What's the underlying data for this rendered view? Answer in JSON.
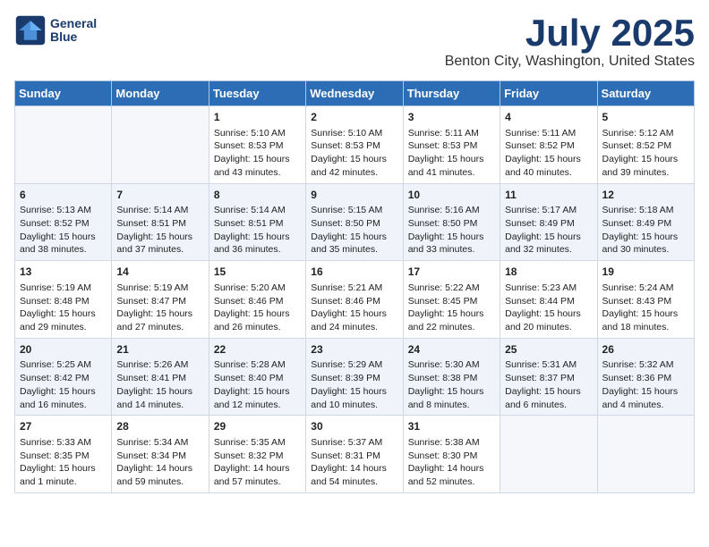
{
  "header": {
    "logo_line1": "General",
    "logo_line2": "Blue",
    "month": "July 2025",
    "location": "Benton City, Washington, United States"
  },
  "weekdays": [
    "Sunday",
    "Monday",
    "Tuesday",
    "Wednesday",
    "Thursday",
    "Friday",
    "Saturday"
  ],
  "weeks": [
    [
      {
        "day": "",
        "sunrise": "",
        "sunset": "",
        "daylight": ""
      },
      {
        "day": "",
        "sunrise": "",
        "sunset": "",
        "daylight": ""
      },
      {
        "day": "1",
        "sunrise": "Sunrise: 5:10 AM",
        "sunset": "Sunset: 8:53 PM",
        "daylight": "Daylight: 15 hours and 43 minutes."
      },
      {
        "day": "2",
        "sunrise": "Sunrise: 5:10 AM",
        "sunset": "Sunset: 8:53 PM",
        "daylight": "Daylight: 15 hours and 42 minutes."
      },
      {
        "day": "3",
        "sunrise": "Sunrise: 5:11 AM",
        "sunset": "Sunset: 8:53 PM",
        "daylight": "Daylight: 15 hours and 41 minutes."
      },
      {
        "day": "4",
        "sunrise": "Sunrise: 5:11 AM",
        "sunset": "Sunset: 8:52 PM",
        "daylight": "Daylight: 15 hours and 40 minutes."
      },
      {
        "day": "5",
        "sunrise": "Sunrise: 5:12 AM",
        "sunset": "Sunset: 8:52 PM",
        "daylight": "Daylight: 15 hours and 39 minutes."
      }
    ],
    [
      {
        "day": "6",
        "sunrise": "Sunrise: 5:13 AM",
        "sunset": "Sunset: 8:52 PM",
        "daylight": "Daylight: 15 hours and 38 minutes."
      },
      {
        "day": "7",
        "sunrise": "Sunrise: 5:14 AM",
        "sunset": "Sunset: 8:51 PM",
        "daylight": "Daylight: 15 hours and 37 minutes."
      },
      {
        "day": "8",
        "sunrise": "Sunrise: 5:14 AM",
        "sunset": "Sunset: 8:51 PM",
        "daylight": "Daylight: 15 hours and 36 minutes."
      },
      {
        "day": "9",
        "sunrise": "Sunrise: 5:15 AM",
        "sunset": "Sunset: 8:50 PM",
        "daylight": "Daylight: 15 hours and 35 minutes."
      },
      {
        "day": "10",
        "sunrise": "Sunrise: 5:16 AM",
        "sunset": "Sunset: 8:50 PM",
        "daylight": "Daylight: 15 hours and 33 minutes."
      },
      {
        "day": "11",
        "sunrise": "Sunrise: 5:17 AM",
        "sunset": "Sunset: 8:49 PM",
        "daylight": "Daylight: 15 hours and 32 minutes."
      },
      {
        "day": "12",
        "sunrise": "Sunrise: 5:18 AM",
        "sunset": "Sunset: 8:49 PM",
        "daylight": "Daylight: 15 hours and 30 minutes."
      }
    ],
    [
      {
        "day": "13",
        "sunrise": "Sunrise: 5:19 AM",
        "sunset": "Sunset: 8:48 PM",
        "daylight": "Daylight: 15 hours and 29 minutes."
      },
      {
        "day": "14",
        "sunrise": "Sunrise: 5:19 AM",
        "sunset": "Sunset: 8:47 PM",
        "daylight": "Daylight: 15 hours and 27 minutes."
      },
      {
        "day": "15",
        "sunrise": "Sunrise: 5:20 AM",
        "sunset": "Sunset: 8:46 PM",
        "daylight": "Daylight: 15 hours and 26 minutes."
      },
      {
        "day": "16",
        "sunrise": "Sunrise: 5:21 AM",
        "sunset": "Sunset: 8:46 PM",
        "daylight": "Daylight: 15 hours and 24 minutes."
      },
      {
        "day": "17",
        "sunrise": "Sunrise: 5:22 AM",
        "sunset": "Sunset: 8:45 PM",
        "daylight": "Daylight: 15 hours and 22 minutes."
      },
      {
        "day": "18",
        "sunrise": "Sunrise: 5:23 AM",
        "sunset": "Sunset: 8:44 PM",
        "daylight": "Daylight: 15 hours and 20 minutes."
      },
      {
        "day": "19",
        "sunrise": "Sunrise: 5:24 AM",
        "sunset": "Sunset: 8:43 PM",
        "daylight": "Daylight: 15 hours and 18 minutes."
      }
    ],
    [
      {
        "day": "20",
        "sunrise": "Sunrise: 5:25 AM",
        "sunset": "Sunset: 8:42 PM",
        "daylight": "Daylight: 15 hours and 16 minutes."
      },
      {
        "day": "21",
        "sunrise": "Sunrise: 5:26 AM",
        "sunset": "Sunset: 8:41 PM",
        "daylight": "Daylight: 15 hours and 14 minutes."
      },
      {
        "day": "22",
        "sunrise": "Sunrise: 5:28 AM",
        "sunset": "Sunset: 8:40 PM",
        "daylight": "Daylight: 15 hours and 12 minutes."
      },
      {
        "day": "23",
        "sunrise": "Sunrise: 5:29 AM",
        "sunset": "Sunset: 8:39 PM",
        "daylight": "Daylight: 15 hours and 10 minutes."
      },
      {
        "day": "24",
        "sunrise": "Sunrise: 5:30 AM",
        "sunset": "Sunset: 8:38 PM",
        "daylight": "Daylight: 15 hours and 8 minutes."
      },
      {
        "day": "25",
        "sunrise": "Sunrise: 5:31 AM",
        "sunset": "Sunset: 8:37 PM",
        "daylight": "Daylight: 15 hours and 6 minutes."
      },
      {
        "day": "26",
        "sunrise": "Sunrise: 5:32 AM",
        "sunset": "Sunset: 8:36 PM",
        "daylight": "Daylight: 15 hours and 4 minutes."
      }
    ],
    [
      {
        "day": "27",
        "sunrise": "Sunrise: 5:33 AM",
        "sunset": "Sunset: 8:35 PM",
        "daylight": "Daylight: 15 hours and 1 minute."
      },
      {
        "day": "28",
        "sunrise": "Sunrise: 5:34 AM",
        "sunset": "Sunset: 8:34 PM",
        "daylight": "Daylight: 14 hours and 59 minutes."
      },
      {
        "day": "29",
        "sunrise": "Sunrise: 5:35 AM",
        "sunset": "Sunset: 8:32 PM",
        "daylight": "Daylight: 14 hours and 57 minutes."
      },
      {
        "day": "30",
        "sunrise": "Sunrise: 5:37 AM",
        "sunset": "Sunset: 8:31 PM",
        "daylight": "Daylight: 14 hours and 54 minutes."
      },
      {
        "day": "31",
        "sunrise": "Sunrise: 5:38 AM",
        "sunset": "Sunset: 8:30 PM",
        "daylight": "Daylight: 14 hours and 52 minutes."
      },
      {
        "day": "",
        "sunrise": "",
        "sunset": "",
        "daylight": ""
      },
      {
        "day": "",
        "sunrise": "",
        "sunset": "",
        "daylight": ""
      }
    ]
  ]
}
